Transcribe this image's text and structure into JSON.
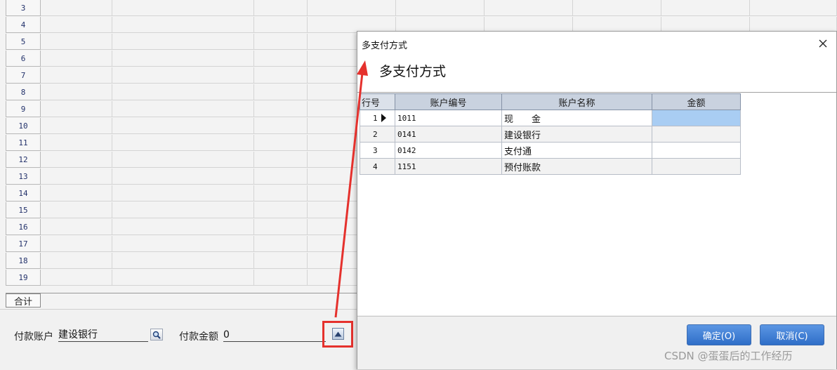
{
  "grid": {
    "row_numbers": [
      "3",
      "4",
      "5",
      "6",
      "7",
      "8",
      "9",
      "10",
      "11",
      "12",
      "13",
      "14",
      "15",
      "16",
      "17",
      "18",
      "19"
    ],
    "total_label": "合计"
  },
  "form": {
    "account_label": "付款账户",
    "account_value": "建设银行",
    "amount_label": "付款金额",
    "amount_value": "0"
  },
  "dialog": {
    "window_title": "多支付方式",
    "close_symbol": "✕",
    "header_title": "多支付方式",
    "columns": [
      "行号",
      "账户编号",
      "账户名称",
      "金额"
    ],
    "rows": [
      {
        "line": "1",
        "code": "1011",
        "name": "现　　金",
        "amount": ""
      },
      {
        "line": "2",
        "code": "0141",
        "name": "建设银行",
        "amount": ""
      },
      {
        "line": "3",
        "code": "0142",
        "name": "支付通",
        "amount": ""
      },
      {
        "line": "4",
        "code": "1151",
        "name": "预付账款",
        "amount": ""
      }
    ],
    "confirm_button": "确定(O)",
    "cancel_button": "取消(C)"
  },
  "watermark": "CSDN @蛋蛋后的工作经历",
  "colors": {
    "accent_button": "#3a7bd5",
    "annotation_red": "#e5312d",
    "selected_cell": "#a9cdf3"
  },
  "icons": {
    "lookup": "magnifier-icon",
    "expand": "triangle-up-icon",
    "close": "close-icon",
    "row_pointer": "row-pointer-icon"
  }
}
